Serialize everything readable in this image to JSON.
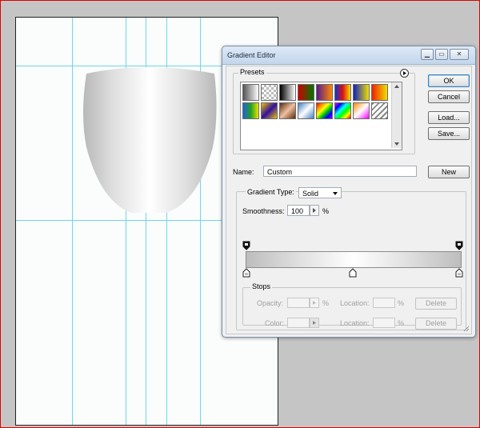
{
  "dialog": {
    "title": "Gradient Editor",
    "presets_label": "Presets",
    "presets_menu_icon": "arrow-right-circle-icon",
    "ok_label": "OK",
    "cancel_label": "Cancel",
    "load_label": "Load...",
    "save_label": "Save...",
    "name_label": "Name:",
    "name_value": "Custom",
    "new_label": "New",
    "gradient_type_label": "Gradient Type:",
    "gradient_type_value": "Solid",
    "smoothness_label": "Smoothness:",
    "smoothness_value": "100",
    "percent": "%",
    "stops_label": "Stops",
    "opacity_label": "Opacity:",
    "color_label": "Color:",
    "location_label": "Location:",
    "delete_label": "Delete",
    "window_buttons": {
      "minimize": "▁",
      "maximize": "▭",
      "close": "✕"
    }
  },
  "gradient": {
    "color_stops": [
      {
        "location": 0,
        "color": "#bdbdbd"
      },
      {
        "location": 50,
        "color": "#ffffff"
      },
      {
        "location": 100,
        "color": "#bdbdbd"
      }
    ],
    "opacity_stops": [
      0,
      100
    ]
  },
  "colors": {
    "guide": "#6fd6e6",
    "frame": "#e00000"
  }
}
